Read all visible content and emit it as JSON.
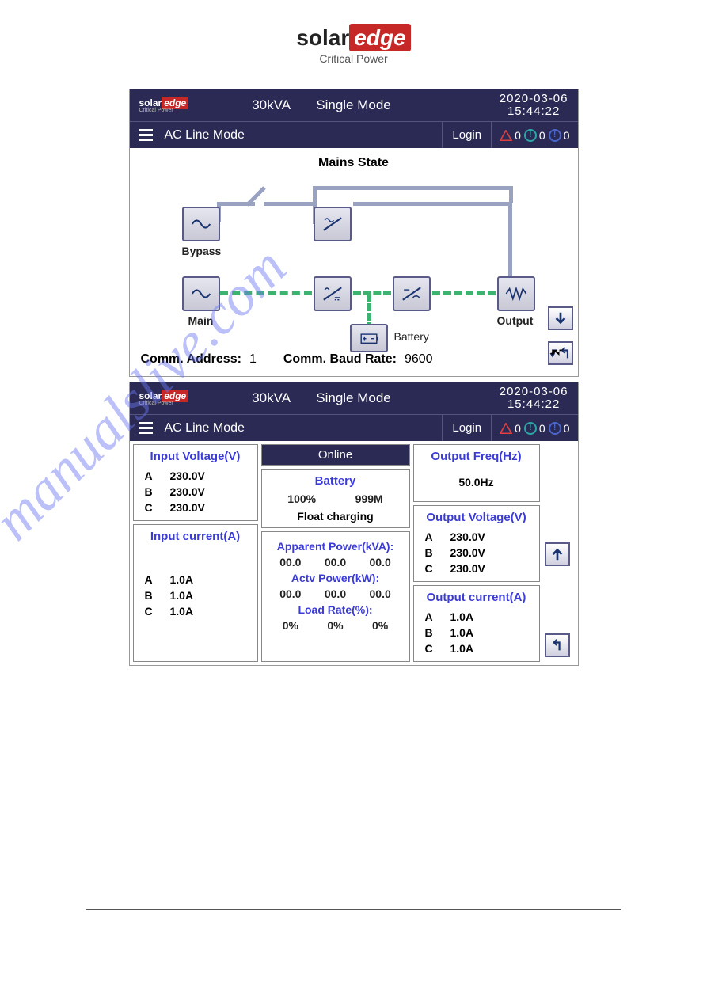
{
  "page_brand": {
    "solar": "solar",
    "edge": "edge",
    "tagline": "Critical Power"
  },
  "watermark": "manualslive.com",
  "panel1": {
    "header": {
      "logo_solar": "solar",
      "logo_edge": "edge",
      "logo_tag": "Critical Power",
      "kva": "30kVA",
      "mode": "Single  Mode",
      "date": "2020-03-06",
      "time": "15:44:22"
    },
    "subbar": {
      "mode": "AC Line Mode",
      "login": "Login",
      "alert_red": "0",
      "alert_teal": "0",
      "alert_blue": "0"
    },
    "title": "Mains State",
    "labels": {
      "bypass": "Bypass",
      "main": "Main",
      "output": "Output",
      "battery": "Battery"
    },
    "comm": {
      "addr_label": "Comm.  Address:",
      "addr": "1",
      "baud_label": "Comm.  Baud Rate:",
      "baud": "9600"
    }
  },
  "panel2": {
    "header": {
      "logo_solar": "solar",
      "logo_edge": "edge",
      "logo_tag": "Critical Power",
      "kva": "30kVA",
      "mode": "Single  Mode",
      "date": "2020-03-06",
      "time": "15:44:22"
    },
    "subbar": {
      "mode": "AC Line Mode",
      "login": "Login",
      "alert_red": "0",
      "alert_teal": "0",
      "alert_blue": "0"
    },
    "status": "Online",
    "input_voltage": {
      "hdr": "Input Voltage(V)",
      "A": "230.0V",
      "B": "230.0V",
      "C": "230.0V"
    },
    "input_current": {
      "hdr": "Input current(A)",
      "A": "1.0A",
      "B": "1.0A",
      "C": "1.0A"
    },
    "battery": {
      "hdr": "Battery",
      "pct": "100%",
      "time": "999M",
      "state": "Float charging"
    },
    "apparent": {
      "hdr": "Apparent Power(kVA):",
      "v1": "00.0",
      "v2": "00.0",
      "v3": "00.0"
    },
    "active": {
      "hdr": "Actv Power(kW):",
      "v1": "00.0",
      "v2": "00.0",
      "v3": "00.0"
    },
    "load": {
      "hdr": "Load Rate(%):",
      "v1": "0%",
      "v2": "0%",
      "v3": "0%"
    },
    "out_freq": {
      "hdr": "Output Freq(Hz)",
      "val": "50.0Hz"
    },
    "out_voltage": {
      "hdr": "Output Voltage(V)",
      "A": "230.0V",
      "B": "230.0V",
      "C": "230.0V"
    },
    "out_current": {
      "hdr": "Output current(A)",
      "A": "1.0A",
      "B": "1.0A",
      "C": "1.0A"
    }
  }
}
